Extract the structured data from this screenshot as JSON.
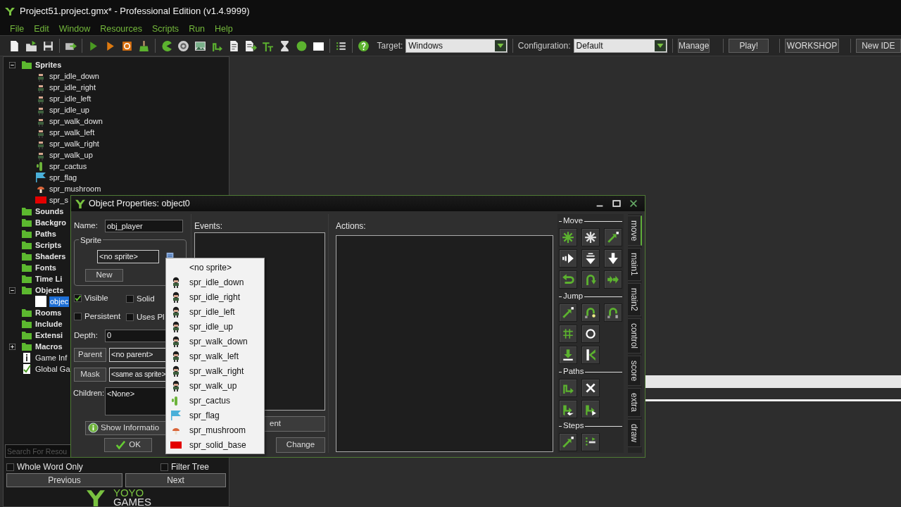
{
  "window": {
    "title": "Project51.project.gmx*  -  Professional Edition (v1.4.9999)"
  },
  "menu": [
    "File",
    "Edit",
    "Window",
    "Resources",
    "Scripts",
    "Run",
    "Help"
  ],
  "toolbar": {
    "target_label": "Target:",
    "target": "Windows",
    "config_label": "Configuration:",
    "config": "Default",
    "buttons": [
      "Manage",
      "Play!",
      "WORKSHOP",
      "New IDE"
    ]
  },
  "tree": [
    {
      "label": "Sprites",
      "kind": "folder",
      "expanded": true,
      "selected": false,
      "children": [
        {
          "label": "spr_idle_down",
          "kind": "character",
          "selected": false
        },
        {
          "label": "spr_idle_right",
          "kind": "character",
          "selected": false
        },
        {
          "label": "spr_idle_left",
          "kind": "character",
          "selected": false
        },
        {
          "label": "spr_idle_up",
          "kind": "character",
          "selected": false
        },
        {
          "label": "spr_walk_down",
          "kind": "character",
          "selected": false
        },
        {
          "label": "spr_walk_left",
          "kind": "character",
          "selected": false
        },
        {
          "label": "spr_walk_right",
          "kind": "character",
          "selected": false
        },
        {
          "label": "spr_walk_up",
          "kind": "character",
          "selected": false
        },
        {
          "label": "spr_cactus",
          "kind": "cactus",
          "selected": false
        },
        {
          "label": "spr_flag",
          "kind": "flag",
          "selected": false
        },
        {
          "label": "spr_mushroom",
          "kind": "mushroom",
          "selected": false
        },
        {
          "label": "spr_s",
          "kind": "block",
          "selected": false
        }
      ]
    },
    {
      "label": "Sounds",
      "kind": "folder",
      "selected": false
    },
    {
      "label": "Backgro",
      "kind": "folder",
      "selected": false
    },
    {
      "label": "Paths",
      "kind": "folder",
      "selected": false
    },
    {
      "label": "Scripts",
      "kind": "folder",
      "selected": false
    },
    {
      "label": "Shaders",
      "kind": "folder",
      "selected": false
    },
    {
      "label": "Fonts",
      "kind": "folder",
      "selected": false
    },
    {
      "label": "Time Li",
      "kind": "folder",
      "selected": false
    },
    {
      "label": "Objects",
      "kind": "folder",
      "expanded": true,
      "selected": false,
      "children": [
        {
          "label": "objec",
          "kind": "object",
          "selected": true
        }
      ]
    },
    {
      "label": "Rooms",
      "kind": "folder",
      "selected": false
    },
    {
      "label": "Include",
      "kind": "folder",
      "selected": false
    },
    {
      "label": "Extensi",
      "kind": "folder",
      "selected": false
    },
    {
      "label": "Macros",
      "kind": "folder",
      "expanded": false,
      "selected": false
    },
    {
      "label": "Game Inf",
      "kind": "info",
      "selected": false
    },
    {
      "label": "Global Ga",
      "kind": "settings",
      "selected": false
    }
  ],
  "search": {
    "placeholder": "Search For Resou"
  },
  "whole_word": {
    "label": "Whole Word Only",
    "checked": false
  },
  "filter_tree": {
    "label": "Filter Tree",
    "checked": false
  },
  "nav_buttons": [
    "Previous",
    "Next"
  ],
  "logo": [
    "YOYO",
    "GAMES"
  ],
  "dialog": {
    "title": "Object Properties: object0",
    "name_label": "Name:",
    "name": "obj_player",
    "sprite_group": "Sprite",
    "sprite": "<no sprite>",
    "new_button": "New",
    "checks": [
      {
        "label": "Visible",
        "checked": true
      },
      {
        "label": "Solid",
        "checked": false
      },
      {
        "label": "Persistent",
        "checked": false
      },
      {
        "label": "Uses Pl",
        "checked": false
      }
    ],
    "depth_label": "Depth:",
    "depth": "0",
    "parent_button": "Parent",
    "parent": "<no parent>",
    "mask_button": "Mask",
    "mask": "<same as sprite>",
    "children_label": "Children:",
    "children": "<None>",
    "info_button": "Show Informatio",
    "ok_button": "OK",
    "events_label": "Events:",
    "add_event_button": "ent",
    "change_button": "Change",
    "actions_label": "Actions:",
    "palette": [
      {
        "title": "Move"
      },
      {
        "title": "Jump"
      },
      {
        "title": "Paths"
      },
      {
        "title": "Steps"
      }
    ],
    "tabs": [
      {
        "label": "move",
        "selected": true
      },
      {
        "label": "main1",
        "selected": false
      },
      {
        "label": "main2",
        "selected": false
      },
      {
        "label": "control",
        "selected": false
      },
      {
        "label": "score",
        "selected": false
      },
      {
        "label": "extra",
        "selected": false
      },
      {
        "label": "draw",
        "selected": false
      }
    ]
  },
  "sprite_menu": [
    {
      "label": "<no sprite>",
      "kind": "none"
    },
    {
      "label": "spr_idle_down",
      "kind": "character"
    },
    {
      "label": "spr_idle_right",
      "kind": "character"
    },
    {
      "label": "spr_idle_left",
      "kind": "character"
    },
    {
      "label": "spr_idle_up",
      "kind": "character"
    },
    {
      "label": "spr_walk_down",
      "kind": "character"
    },
    {
      "label": "spr_walk_left",
      "kind": "character"
    },
    {
      "label": "spr_walk_right",
      "kind": "character"
    },
    {
      "label": "spr_walk_up",
      "kind": "character"
    },
    {
      "label": "spr_cactus",
      "kind": "cactus"
    },
    {
      "label": "spr_flag",
      "kind": "flag"
    },
    {
      "label": "spr_mushroom",
      "kind": "mushroom"
    },
    {
      "label": "spr_solid_base",
      "kind": "block"
    }
  ]
}
